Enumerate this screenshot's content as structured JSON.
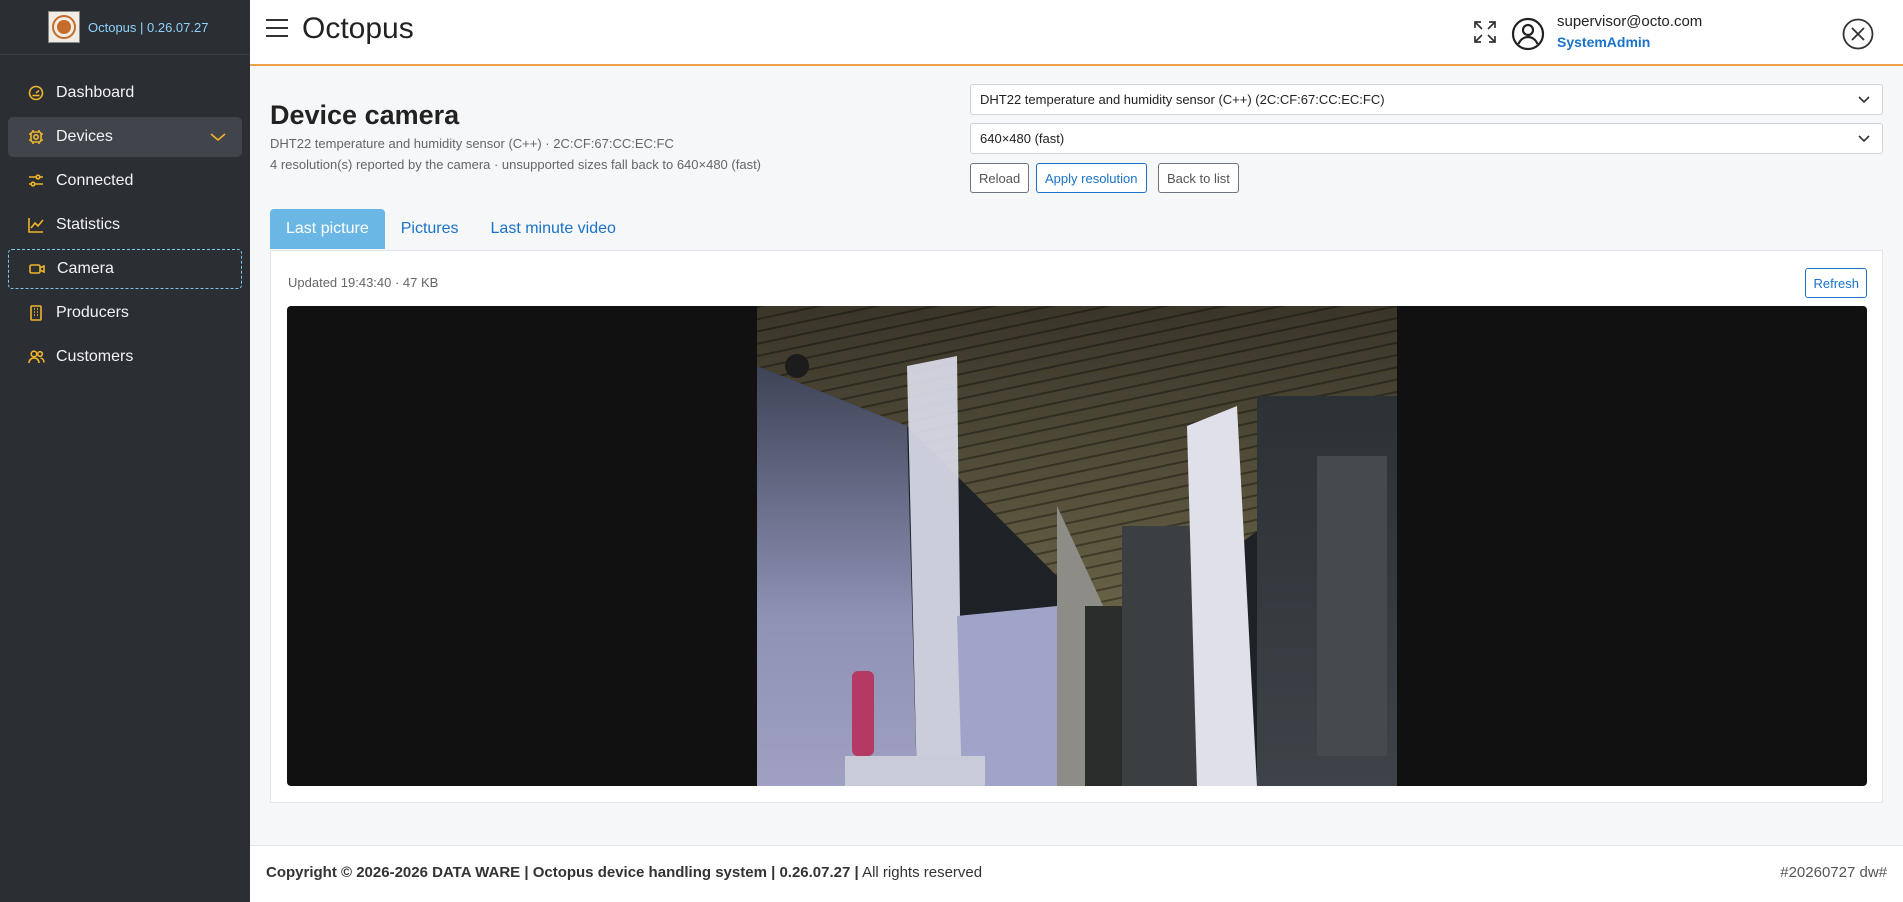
{
  "brand": {
    "text": "Octopus | 0.26.07.27"
  },
  "sidebar": {
    "items": [
      {
        "label": "Dashboard",
        "icon": "gauge-icon"
      },
      {
        "label": "Devices",
        "icon": "chip-icon"
      },
      {
        "label": "Connected",
        "icon": "sliders-icon"
      },
      {
        "label": "Statistics",
        "icon": "chart-line-icon"
      },
      {
        "label": "Camera",
        "icon": "camera-icon"
      },
      {
        "label": "Producers",
        "icon": "building-icon"
      },
      {
        "label": "Customers",
        "icon": "users-icon"
      }
    ]
  },
  "header": {
    "title": "Octopus",
    "user_email": "supervisor@octo.com",
    "user_role": "SystemAdmin"
  },
  "page": {
    "title": "Device camera",
    "subtitle": "DHT22 temperature and humidity sensor (C++) · 2C:CF:67:CC:EC:FC",
    "note": "4 resolution(s) reported by the camera · unsupported sizes fall back to 640×480 (fast)"
  },
  "controls": {
    "device_select": "DHT22 temperature and humidity sensor (C++) (2C:CF:67:CC:EC:FC)",
    "resolution_select": "640×480 (fast)",
    "reload_label": "Reload",
    "apply_label": "Apply resolution",
    "back_label": "Back to list"
  },
  "tabs": [
    {
      "label": "Last picture"
    },
    {
      "label": "Pictures"
    },
    {
      "label": "Last minute video"
    }
  ],
  "panel": {
    "updated": "Updated 19:43:40 · 47 KB",
    "refresh_label": "Refresh"
  },
  "footer": {
    "copyright": "Copyright © 2026-2026 DATA WARE | Octopus device handling system | 0.26.07.27 |",
    "rights": "All rights reserved",
    "build": "#20260727 dw#"
  },
  "colors": {
    "sidebar_bg": "#2b2e32",
    "accent_icon": "#f0b429",
    "link_blue": "#1a73c8",
    "header_border": "#f0a24a",
    "tab_active": "#6ab7e6"
  }
}
